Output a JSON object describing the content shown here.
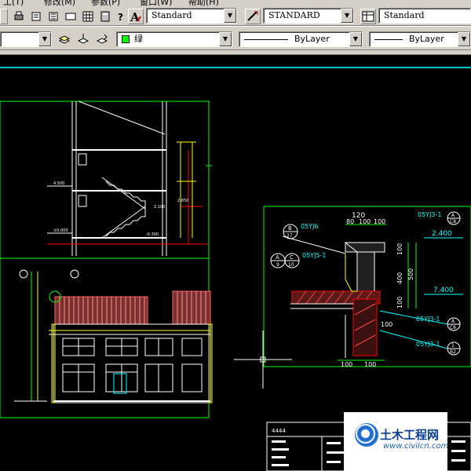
{
  "menubar": {
    "items": [
      "工(T)",
      "修改(M)",
      "参数(P)",
      "窗口(W)",
      "帮助(H)"
    ]
  },
  "toolbar1": {
    "text_style": "Standard",
    "dim_style": "STANDARD",
    "table_style": "Standard"
  },
  "toolbar2": {
    "color": "绿",
    "linetype": "ByLayer",
    "lineweight": "ByLayer"
  },
  "drawing": {
    "section_labels": [
      "4.500",
      "±0.000",
      "-0.300",
      "2.100",
      "2.850"
    ],
    "detail_refs": [
      {
        "top": "B",
        "bottom": "27",
        "code": "05YJ6"
      },
      {
        "top": "A",
        "bottom": "9",
        "code": ""
      },
      {
        "top": "C",
        "bottom": "10",
        "code": "05YJ5-1"
      },
      {
        "top": "A",
        "bottom": "C8",
        "code": "05YJ3-1"
      },
      {
        "top": "A",
        "bottom": "C6",
        "code": "05YJ3-1"
      },
      {
        "top": "1",
        "bottom": "B2",
        "code": "05YJ3-1"
      }
    ],
    "dims": [
      "120",
      "80",
      "100",
      "100",
      "100",
      "400",
      "500",
      "100",
      "100",
      "100",
      "100"
    ],
    "elevations": [
      "2.400",
      "7.400"
    ],
    "title_block": "4444"
  },
  "watermark": {
    "title": "土木工程网",
    "url": "www.civilcn.com"
  },
  "colors": {
    "ui_face": "#d4d0c8",
    "cad_bg": "#000000",
    "frame": "#00ff00",
    "dim": "#00ff00",
    "wall": "#ff0000",
    "leader": "#ffff00",
    "accent": "#00c8c8"
  }
}
